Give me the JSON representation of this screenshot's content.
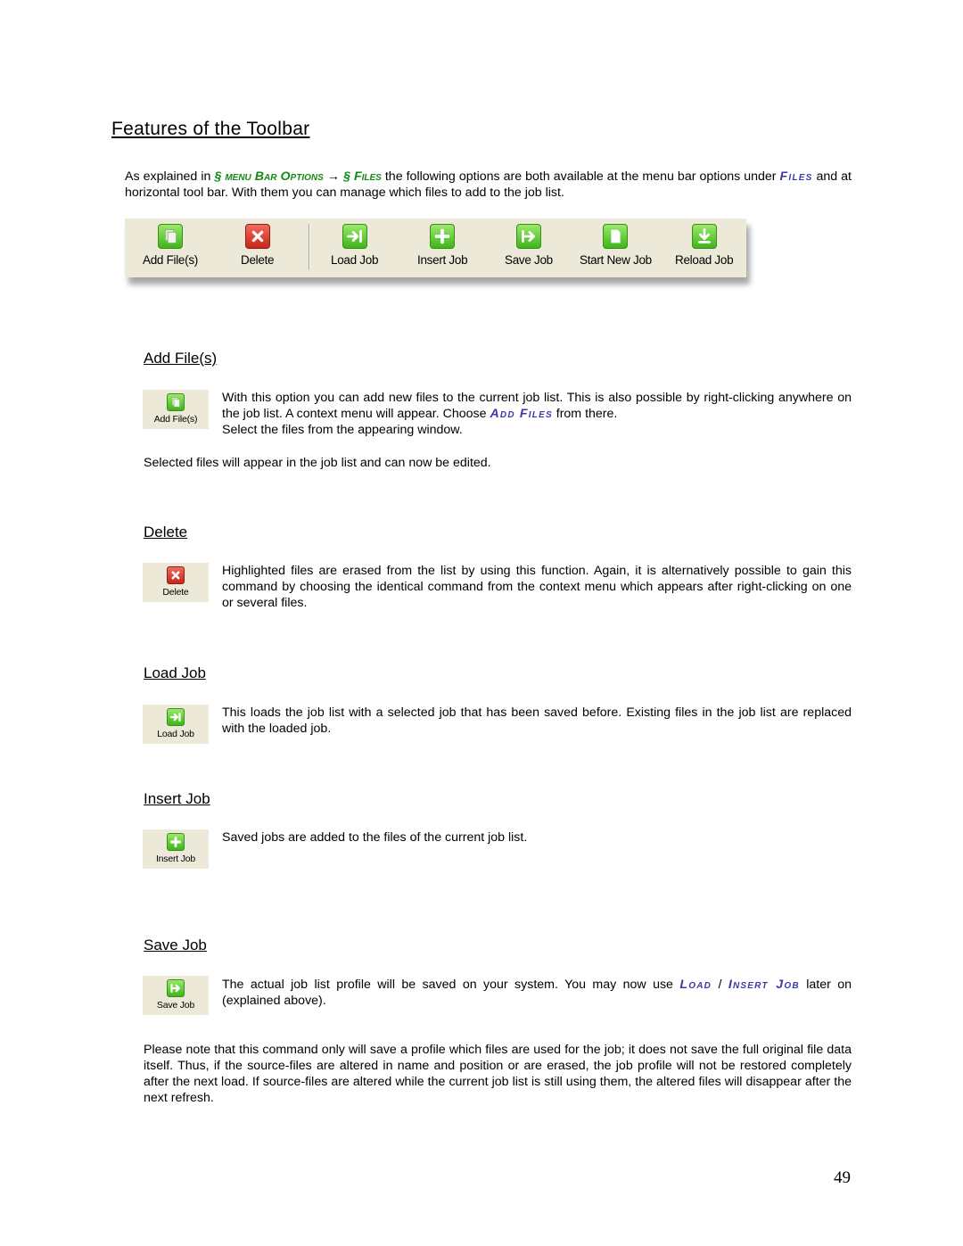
{
  "title": "Features of the Toolbar",
  "intro": {
    "t1": "As explained in ",
    "ref1": "§ menu Bar Options",
    "arrow": " → ",
    "ref2": "§ Files",
    "t2": " the following options are both available at the menu bar options under ",
    "ref3": "Files",
    "t3": " and at horizontal tool bar. With them you can manage which files to add to the job list."
  },
  "toolbar": {
    "buttons": [
      {
        "label": "Add File(s)",
        "icon": "add-files-icon"
      },
      {
        "label": "Delete",
        "icon": "delete-icon"
      },
      {
        "label": "Load Job",
        "icon": "load-job-icon"
      },
      {
        "label": "Insert Job",
        "icon": "insert-job-icon"
      },
      {
        "label": "Save Job",
        "icon": "save-job-icon"
      },
      {
        "label": "Start New Job",
        "icon": "start-new-job-icon"
      },
      {
        "label": "Reload Job",
        "icon": "reload-job-icon"
      }
    ]
  },
  "sections": {
    "add_files": {
      "title": "Add File(s)",
      "button_label": "Add File(s)",
      "desc_a": "With this option you can add new files to the current job list. This is also possible by right-clicking anywhere on the job list.  A context menu will appear. Choose ",
      "desc_ref": "Add Files",
      "desc_b": " from there.",
      "desc_c": "Select the files from the appearing window.",
      "note": "Selected files will appear in the job list and can now be edited."
    },
    "delete": {
      "title": "Delete",
      "button_label": "Delete",
      "desc": "Highlighted files are erased from the list by using this function. Again, it is alternatively possible to gain this command by choosing the identical command from the context menu which appears after right-clicking on one or several files."
    },
    "load_job": {
      "title": "Load Job",
      "button_label": "Load Job",
      "desc": "This loads the job list with a selected job that has been saved before. Existing files in the job list are replaced with the loaded job."
    },
    "insert_job": {
      "title": "Insert Job",
      "button_label": "Insert Job",
      "desc": "Saved jobs are added to the files of the current job list."
    },
    "save_job": {
      "title": "Save Job",
      "button_label": "Save Job",
      "desc_a": "The actual job list profile will be saved on your system. You may now use ",
      "desc_ref1": "Load",
      "desc_sep": " / ",
      "desc_ref2": "Insert Job",
      "desc_b": " later on (explained above).",
      "note": "Please note that this command only will save a profile which files are used for the job; it does not save the full original file data itself. Thus, if the source-files are altered in name and position or are erased, the job profile will not be restored completely after the next load. If source-files are altered while the current job list is still using them, the altered files will disappear after the next refresh."
    }
  },
  "page_number": "49",
  "colors": {
    "green_ref": "#138a13",
    "blue_ref": "#3a3aa8",
    "toolbar_bg": "#ece9d8"
  }
}
